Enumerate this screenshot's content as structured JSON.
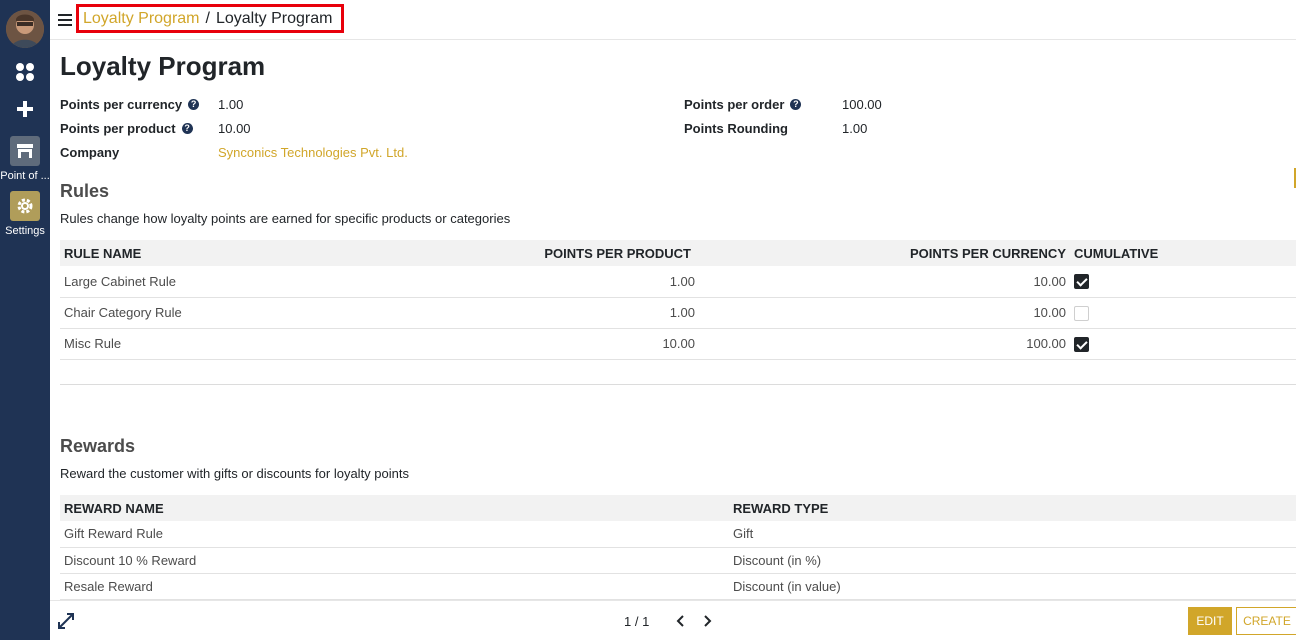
{
  "sidebar": {
    "apps": [
      {
        "label": "Point of ...",
        "icon": "store-icon"
      },
      {
        "label": "Settings",
        "icon": "gear-icon"
      }
    ]
  },
  "breadcrumb": {
    "parent": "Loyalty Program",
    "separator": "/",
    "current": "Loyalty Program"
  },
  "form": {
    "title": "Loyalty Program",
    "fields_left": [
      {
        "label": "Points per currency",
        "value": "1.00",
        "help": true
      },
      {
        "label": "Points per product",
        "value": "10.00",
        "help": true
      },
      {
        "label": "Company",
        "value": "Synconics Technologies Pvt. Ltd.",
        "help": false
      }
    ],
    "fields_right": [
      {
        "label": "Points per order",
        "value": "100.00",
        "help": true
      },
      {
        "label": "Points Rounding",
        "value": "1.00",
        "help": false
      }
    ]
  },
  "rules": {
    "title": "Rules",
    "description": "Rules change how loyalty points are earned for specific products or categories",
    "columns": [
      "RULE NAME",
      "POINTS PER PRODUCT",
      "POINTS PER CURRENCY",
      "CUMULATIVE"
    ],
    "rows": [
      {
        "name": "Large Cabinet Rule",
        "per_product": "1.00",
        "per_currency": "10.00",
        "cumulative": true
      },
      {
        "name": "Chair Category Rule",
        "per_product": "1.00",
        "per_currency": "10.00",
        "cumulative": false
      },
      {
        "name": "Misc Rule",
        "per_product": "10.00",
        "per_currency": "100.00",
        "cumulative": true
      }
    ]
  },
  "rewards": {
    "title": "Rewards",
    "description": "Reward the customer with gifts or discounts for loyalty points",
    "columns": [
      "REWARD NAME",
      "REWARD TYPE"
    ],
    "rows": [
      {
        "name": "Gift Reward Rule",
        "type": "Gift"
      },
      {
        "name": "Discount 10 % Reward",
        "type": "Discount (in %)"
      },
      {
        "name": "Resale Reward",
        "type": "Discount (in value)"
      }
    ]
  },
  "bottombar": {
    "pager": "1 / 1",
    "edit_label": "EDIT",
    "create_label": "CREATE"
  },
  "colors": {
    "sidebar": "#1f3354",
    "accent": "#d1a62a",
    "highlight_box": "#e8000b"
  }
}
